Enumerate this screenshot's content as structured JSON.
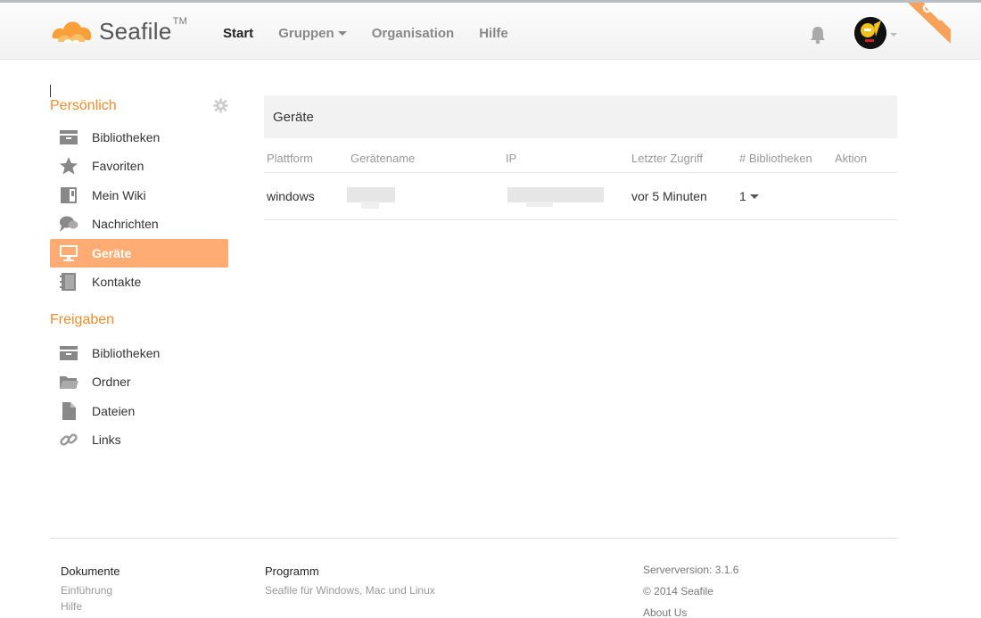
{
  "app": {
    "logo_text": "Seafile",
    "logo_tm": "TM",
    "brand_color": "#f08b2c",
    "active_color": "#feac74"
  },
  "nav": {
    "items": [
      {
        "label": "Start",
        "active": true
      },
      {
        "label": "Gruppen",
        "has_caret": true
      },
      {
        "label": "Organisation"
      },
      {
        "label": "Hilfe"
      }
    ]
  },
  "header_icons": {
    "notifications": "bell-icon",
    "avatar": "user-avatar",
    "admin_corner": "wrench-icon"
  },
  "sidebar": {
    "personal_heading": "Persönlich",
    "personal_items": [
      {
        "label": "Bibliotheken",
        "icon": "library-icon"
      },
      {
        "label": "Favoriten",
        "icon": "star-icon"
      },
      {
        "label": "Mein Wiki",
        "icon": "wiki-icon"
      },
      {
        "label": "Nachrichten",
        "icon": "chat-icon"
      },
      {
        "label": "Geräte",
        "icon": "monitor-icon",
        "active": true
      },
      {
        "label": "Kontakte",
        "icon": "contacts-icon"
      }
    ],
    "shares_heading": "Freigaben",
    "share_items": [
      {
        "label": "Bibliotheken",
        "icon": "library-icon"
      },
      {
        "label": "Ordner",
        "icon": "folder-icon"
      },
      {
        "label": "Dateien",
        "icon": "file-icon"
      },
      {
        "label": "Links",
        "icon": "link-icon"
      }
    ]
  },
  "main": {
    "title": "Geräte",
    "columns": [
      "Plattform",
      "Gerätename",
      "IP",
      "Letzter Zugriff",
      "# Bibliotheken",
      "Aktion"
    ],
    "rows": [
      {
        "platform": "windows",
        "device_name": "",
        "ip": "",
        "last_access": "vor 5 Minuten",
        "libraries": "1"
      }
    ]
  },
  "footer": {
    "docs_heading": "Dokumente",
    "docs_links": [
      "Einführung",
      "Hilfe"
    ],
    "program_heading": "Programm",
    "program_link": "Seafile für Windows, Mac und Linux",
    "server_version": "Serverversion: 3.1.6",
    "copyright": "© 2014 Seafile",
    "about": "About Us"
  }
}
